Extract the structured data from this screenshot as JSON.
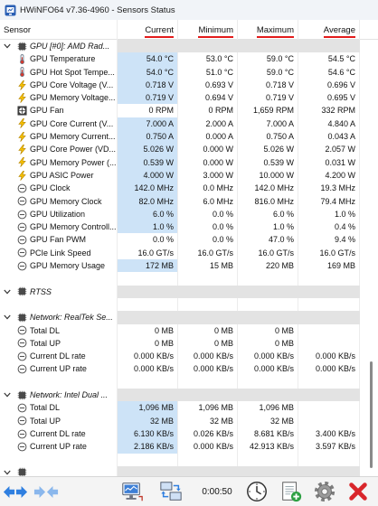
{
  "window": {
    "title": "HWiNFO64 v7.36-4960 - Sensors Status"
  },
  "columns": {
    "sensor": "Sensor",
    "current": "Current",
    "minimum": "Minimum",
    "maximum": "Maximum",
    "average": "Average"
  },
  "rows": [
    {
      "section": "GPU [#0]: AMD Rad..."
    },
    {
      "icon": "thermometer-icon",
      "label": "GPU Temperature",
      "current": "54.0 °C",
      "minimum": "53.0 °C",
      "maximum": "59.0 °C",
      "average": "54.5 °C",
      "highlight": true
    },
    {
      "icon": "thermometer-icon",
      "label": "GPU Hot Spot Tempe...",
      "current": "54.0 °C",
      "minimum": "51.0 °C",
      "maximum": "59.0 °C",
      "average": "54.6 °C",
      "highlight": true
    },
    {
      "icon": "lightning-icon",
      "label": "GPU Core Voltage (V...",
      "current": "0.718 V",
      "minimum": "0.693 V",
      "maximum": "0.718 V",
      "average": "0.696 V",
      "highlight": true
    },
    {
      "icon": "lightning-icon",
      "label": "GPU Memory Voltage...",
      "current": "0.719 V",
      "minimum": "0.694 V",
      "maximum": "0.719 V",
      "average": "0.695 V",
      "highlight": true
    },
    {
      "icon": "fan-icon",
      "label": "GPU Fan",
      "current": "0 RPM",
      "minimum": "0 RPM",
      "maximum": "1,659 RPM",
      "average": "332 RPM",
      "highlight": false
    },
    {
      "icon": "lightning-icon",
      "label": "GPU Core Current (V...",
      "current": "7.000 A",
      "minimum": "2.000 A",
      "maximum": "7.000 A",
      "average": "4.840 A",
      "highlight": true
    },
    {
      "icon": "lightning-icon",
      "label": "GPU Memory Current...",
      "current": "0.750 A",
      "minimum": "0.000 A",
      "maximum": "0.750 A",
      "average": "0.043 A",
      "highlight": true
    },
    {
      "icon": "lightning-icon",
      "label": "GPU Core Power (VD...",
      "current": "5.026 W",
      "minimum": "0.000 W",
      "maximum": "5.026 W",
      "average": "2.057 W",
      "highlight": true
    },
    {
      "icon": "lightning-icon",
      "label": "GPU Memory Power (...",
      "current": "0.539 W",
      "minimum": "0.000 W",
      "maximum": "0.539 W",
      "average": "0.031 W",
      "highlight": true
    },
    {
      "icon": "lightning-icon",
      "label": "GPU ASIC Power",
      "current": "4.000 W",
      "minimum": "3.000 W",
      "maximum": "10.000 W",
      "average": "4.200 W",
      "highlight": true
    },
    {
      "icon": "sensor-circle-icon",
      "label": "GPU Clock",
      "current": "142.0 MHz",
      "minimum": "0.0 MHz",
      "maximum": "142.0 MHz",
      "average": "19.3 MHz",
      "highlight": true
    },
    {
      "icon": "sensor-circle-icon",
      "label": "GPU Memory Clock",
      "current": "82.0 MHz",
      "minimum": "6.0 MHz",
      "maximum": "816.0 MHz",
      "average": "79.4 MHz",
      "highlight": true
    },
    {
      "icon": "sensor-circle-icon",
      "label": "GPU Utilization",
      "current": "6.0 %",
      "minimum": "0.0 %",
      "maximum": "6.0 %",
      "average": "1.0 %",
      "highlight": true
    },
    {
      "icon": "sensor-circle-icon",
      "label": "GPU Memory Controll...",
      "current": "1.0 %",
      "minimum": "0.0 %",
      "maximum": "1.0 %",
      "average": "0.4 %",
      "highlight": true
    },
    {
      "icon": "sensor-circle-icon",
      "label": "GPU Fan PWM",
      "current": "0.0 %",
      "minimum": "0.0 %",
      "maximum": "47.0 %",
      "average": "9.4 %",
      "highlight": false
    },
    {
      "icon": "sensor-circle-icon",
      "label": "PCIe Link Speed",
      "current": "16.0 GT/s",
      "minimum": "16.0 GT/s",
      "maximum": "16.0 GT/s",
      "average": "16.0 GT/s",
      "highlight": false
    },
    {
      "icon": "sensor-circle-icon",
      "label": "GPU Memory Usage",
      "current": "172 MB",
      "minimum": "15 MB",
      "maximum": "220 MB",
      "average": "169 MB",
      "highlight": true
    },
    {},
    {
      "section": "RTSS"
    },
    {},
    {
      "section": "Network: RealTek Se..."
    },
    {
      "icon": "sensor-circle-icon",
      "label": "Total DL",
      "current": "0 MB",
      "minimum": "0 MB",
      "maximum": "0 MB",
      "average": "",
      "highlight": false
    },
    {
      "icon": "sensor-circle-icon",
      "label": "Total UP",
      "current": "0 MB",
      "minimum": "0 MB",
      "maximum": "0 MB",
      "average": "",
      "highlight": false
    },
    {
      "icon": "sensor-circle-icon",
      "label": "Current DL rate",
      "current": "0.000 KB/s",
      "minimum": "0.000 KB/s",
      "maximum": "0.000 KB/s",
      "average": "0.000 KB/s",
      "highlight": false
    },
    {
      "icon": "sensor-circle-icon",
      "label": "Current UP rate",
      "current": "0.000 KB/s",
      "minimum": "0.000 KB/s",
      "maximum": "0.000 KB/s",
      "average": "0.000 KB/s",
      "highlight": false
    },
    {},
    {
      "section": "Network: Intel Dual ..."
    },
    {
      "icon": "sensor-circle-icon",
      "label": "Total DL",
      "current": "1,096 MB",
      "minimum": "1,096 MB",
      "maximum": "1,096 MB",
      "average": "",
      "highlight": true
    },
    {
      "icon": "sensor-circle-icon",
      "label": "Total UP",
      "current": "32 MB",
      "minimum": "32 MB",
      "maximum": "32 MB",
      "average": "",
      "highlight": true
    },
    {
      "icon": "sensor-circle-icon",
      "label": "Current DL rate",
      "current": "6.130 KB/s",
      "minimum": "0.026 KB/s",
      "maximum": "8.681 KB/s",
      "average": "3.400 KB/s",
      "highlight": true
    },
    {
      "icon": "sensor-circle-icon",
      "label": "Current UP rate",
      "current": "2.186 KB/s",
      "minimum": "0.000 KB/s",
      "maximum": "42.913 KB/s",
      "average": "3.597 KB/s",
      "highlight": true
    },
    {},
    {
      "section": ""
    }
  ],
  "toolbar": {
    "elapsed_time": "0:00:50"
  },
  "colors": {
    "current_highlight": "#cde3f7",
    "section_band": "#e3e3e3",
    "header_underline": "#e31c1c"
  }
}
